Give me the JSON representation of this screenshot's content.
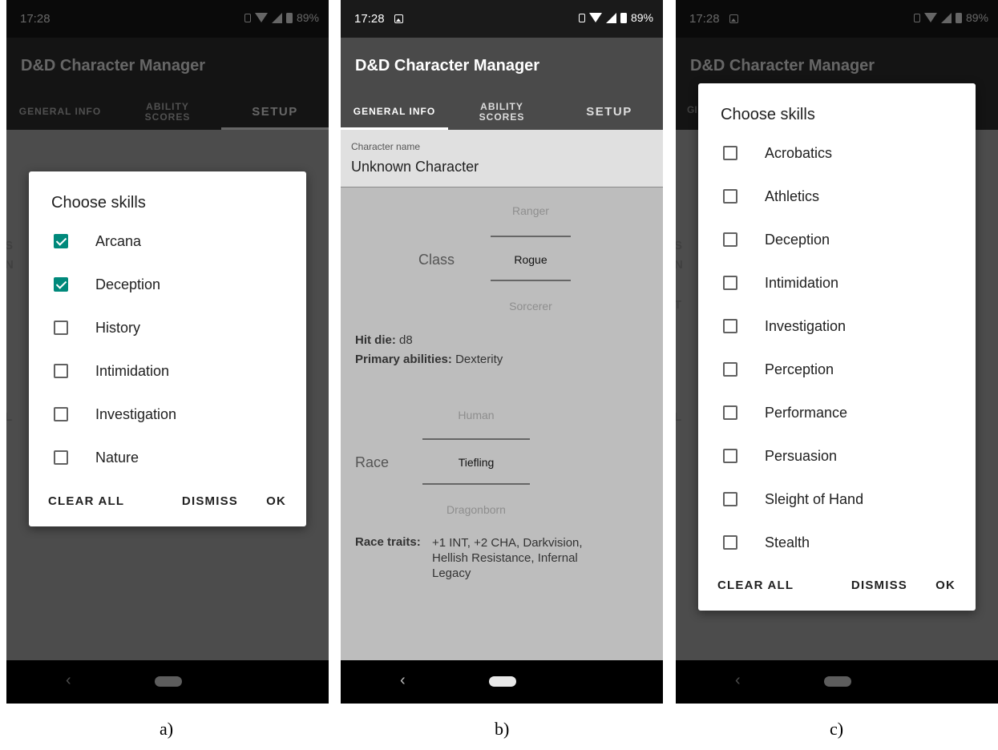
{
  "status": {
    "time": "17:28",
    "battery": "89%"
  },
  "app": {
    "title": "D&D Character Manager"
  },
  "tabs": [
    {
      "label": "GENERAL INFO"
    },
    {
      "label": "ABILITY SCORES"
    },
    {
      "label": "SETUP"
    }
  ],
  "bg_hints_a": [
    "S",
    "N",
    "L"
  ],
  "bg_hints_c": [
    "GI",
    "S",
    "N",
    "T",
    "L"
  ],
  "dialog_a": {
    "title": "Choose skills",
    "items": [
      {
        "label": "Arcana",
        "checked": true
      },
      {
        "label": "Deception",
        "checked": true
      },
      {
        "label": "History",
        "checked": false
      },
      {
        "label": "Intimidation",
        "checked": false
      },
      {
        "label": "Investigation",
        "checked": false
      },
      {
        "label": "Nature",
        "checked": false
      }
    ],
    "clear": "CLEAR ALL",
    "dismiss": "DISMISS",
    "ok": "OK"
  },
  "dialog_c": {
    "title": "Choose skills",
    "items": [
      {
        "label": "Acrobatics",
        "checked": false
      },
      {
        "label": "Athletics",
        "checked": false
      },
      {
        "label": "Deception",
        "checked": false
      },
      {
        "label": "Intimidation",
        "checked": false
      },
      {
        "label": "Investigation",
        "checked": false
      },
      {
        "label": "Perception",
        "checked": false
      },
      {
        "label": "Performance",
        "checked": false
      },
      {
        "label": "Persuasion",
        "checked": false
      },
      {
        "label": "Sleight of Hand",
        "checked": false
      },
      {
        "label": "Stealth",
        "checked": false
      }
    ],
    "clear": "CLEAR ALL",
    "dismiss": "DISMISS",
    "ok": "OK"
  },
  "general": {
    "name_label": "Character name",
    "name_value": "Unknown Character",
    "class_label": "Class",
    "class_prev": "Ranger",
    "class_selected": "Rogue",
    "class_next": "Sorcerer",
    "hit_die_label": "Hit die:",
    "hit_die_value": "d8",
    "primary_label": "Primary abilities:",
    "primary_value": "Dexterity",
    "race_label": "Race",
    "race_prev": "Human",
    "race_selected": "Tiefling",
    "race_next": "Dragonborn",
    "traits_label": "Race traits:",
    "traits_line1": "+1 INT, +2 CHA, Darkvision,",
    "traits_line2": "Hellish Resistance, Infernal",
    "traits_line3": "Legacy"
  },
  "captions": {
    "a": "a)",
    "b": "b)",
    "c": "c)"
  },
  "icons": [
    "image-icon",
    "vibrate-icon",
    "wifi-icon",
    "signal-icon",
    "battery-icon",
    "back-icon",
    "home-pill-icon"
  ],
  "colors": {
    "checkbox_checked": "#00897b"
  }
}
